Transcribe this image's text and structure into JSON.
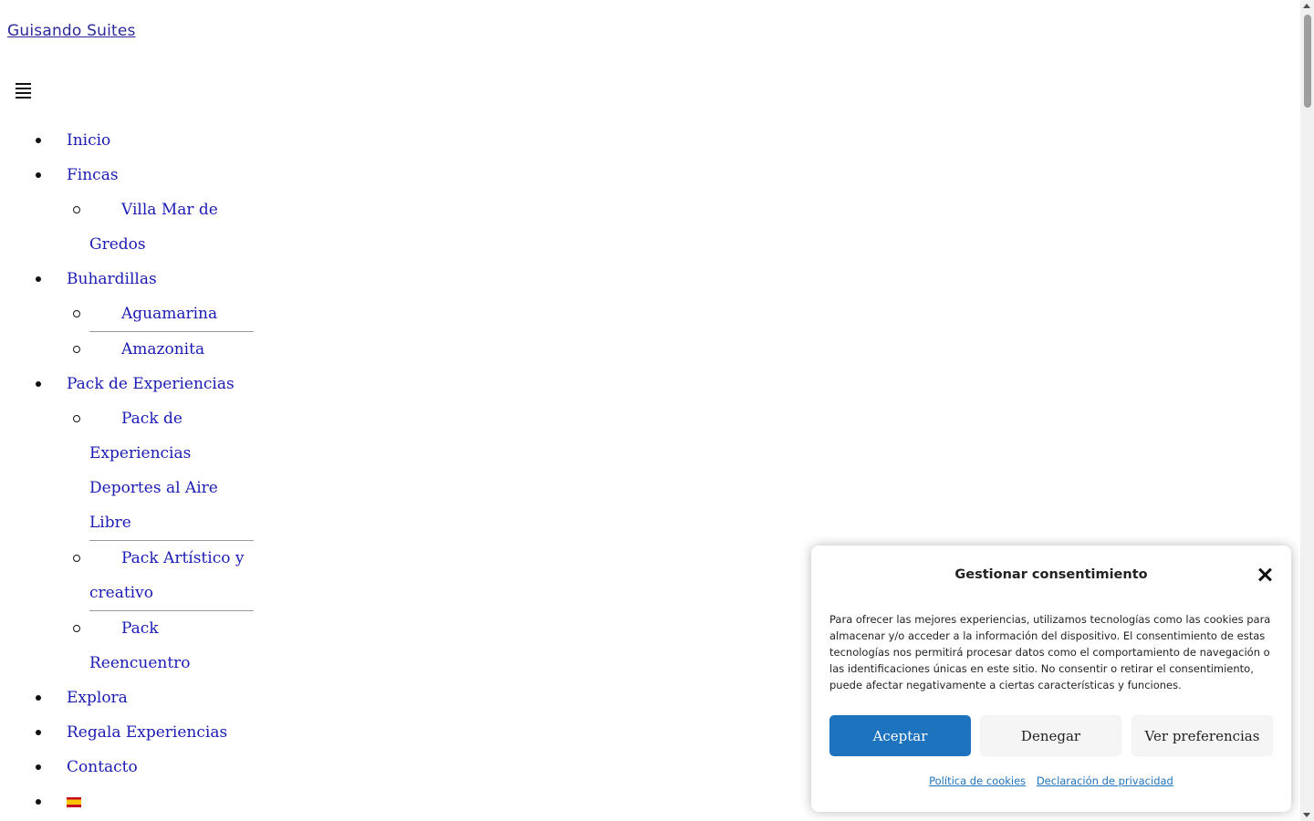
{
  "site": {
    "title": "Guisando Suites"
  },
  "nav": {
    "items": [
      {
        "label": "Inicio"
      },
      {
        "label": "Fincas",
        "children": [
          {
            "label": "Villa Mar de Gredos"
          }
        ]
      },
      {
        "label": "Buhardillas",
        "children": [
          {
            "label": "Aguamarina"
          },
          {
            "label": "Amazonita"
          }
        ]
      },
      {
        "label": "Pack de Experiencias",
        "children": [
          {
            "label": "Pack de Experiencias Deportes al Aire Libre"
          },
          {
            "label": "Pack Artístico y creativo"
          },
          {
            "label": "Pack Reencuentro"
          }
        ]
      },
      {
        "label": "Explora"
      },
      {
        "label": "Regala Experiencias"
      },
      {
        "label": "Contacto"
      }
    ],
    "language_flag": "spain-flag-icon"
  },
  "consent": {
    "title": "Gestionar consentimiento",
    "body": "Para ofrecer las mejores experiencias, utilizamos tecnologías como las cookies para almacenar y/o acceder a la información del dispositivo. El consentimiento de estas tecnologías nos permitirá procesar datos como el comportamiento de navegación o las identificaciones únicas en este sitio. No consentir o retirar el consentimiento, puede afectar negativamente a ciertas características y funciones.",
    "accept_label": "Aceptar",
    "deny_label": "Denegar",
    "prefs_label": "Ver preferencias",
    "cookie_policy_label": "Política de cookies",
    "privacy_label": "Declaración de privacidad"
  },
  "colors": {
    "link": "#1b1bb5",
    "accent": "#1e73be"
  }
}
